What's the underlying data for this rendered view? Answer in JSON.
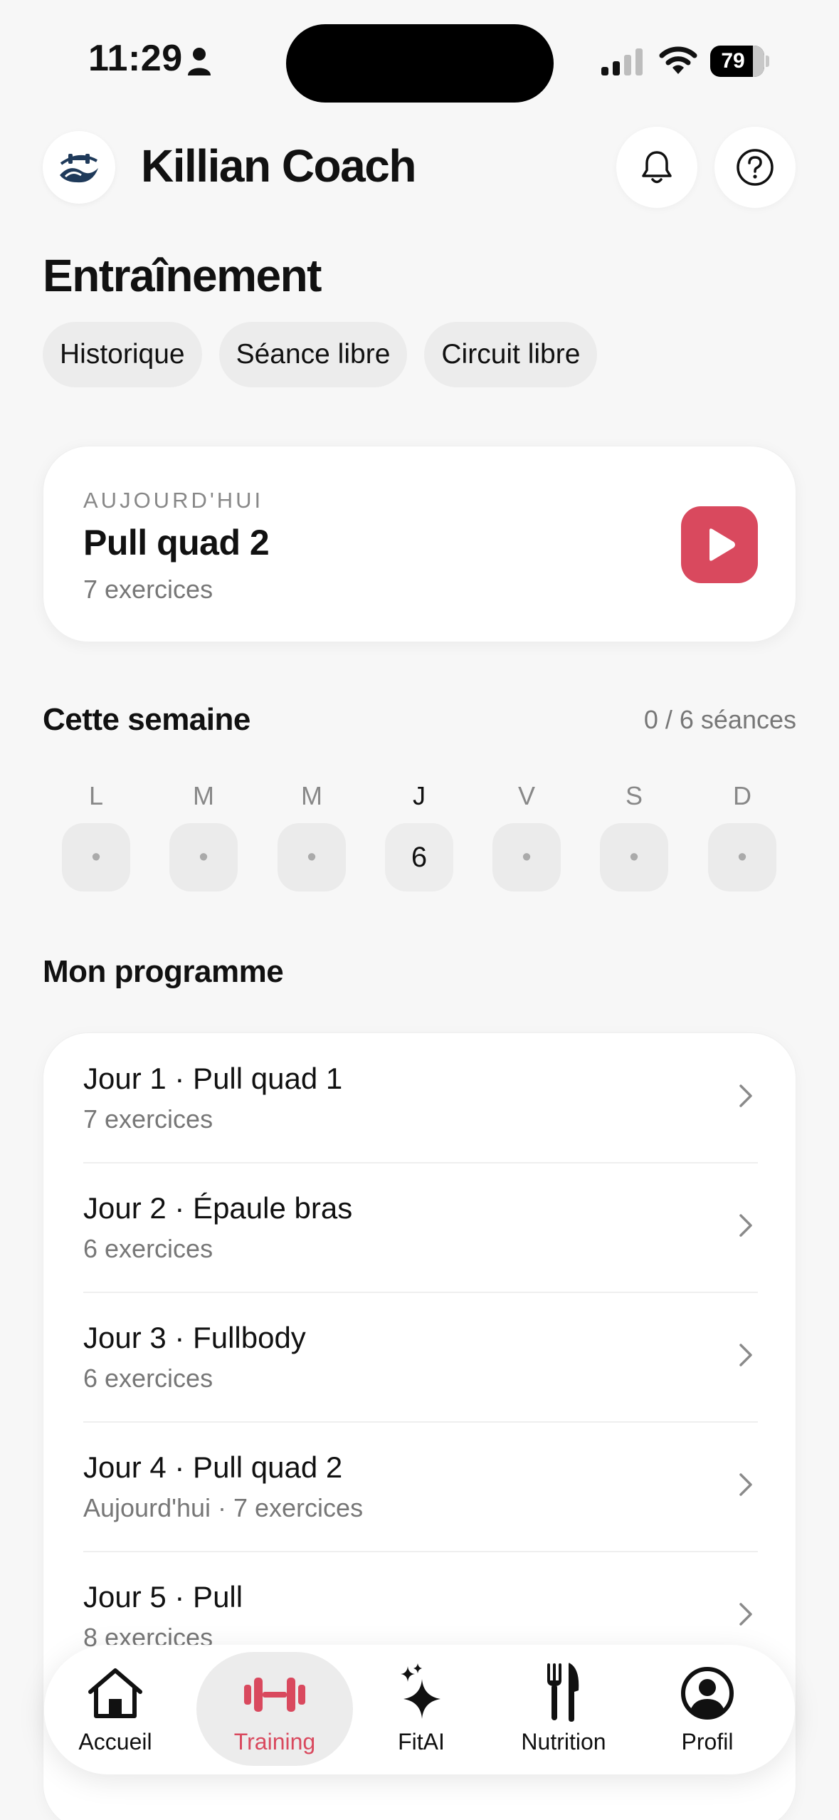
{
  "status_bar": {
    "time": "11:29",
    "battery": "79"
  },
  "header": {
    "title": "Killian Coach"
  },
  "section": {
    "title": "Entraînement",
    "chips": [
      "Historique",
      "Séance libre",
      "Circuit libre"
    ]
  },
  "today": {
    "kicker": "AUJOURD'HUI",
    "title": "Pull quad 2",
    "subtitle": "7 exercices"
  },
  "week": {
    "title": "Cette semaine",
    "count": "0 / 6 séances",
    "days": [
      {
        "label": "L",
        "value": "•"
      },
      {
        "label": "M",
        "value": "•"
      },
      {
        "label": "M",
        "value": "•"
      },
      {
        "label": "J",
        "value": "6"
      },
      {
        "label": "V",
        "value": "•"
      },
      {
        "label": "S",
        "value": "•"
      },
      {
        "label": "D",
        "value": "•"
      }
    ]
  },
  "program": {
    "title": "Mon programme",
    "items": [
      {
        "title": "Jour 1 · Pull quad 1",
        "subtitle": "7 exercices"
      },
      {
        "title": "Jour 2 · Épaule bras",
        "subtitle": "6 exercices"
      },
      {
        "title": "Jour 3 · Fullbody",
        "subtitle": "6 exercices"
      },
      {
        "title": "Jour 4 · Pull quad 2",
        "subtitle": "Aujourd'hui · 7 exercices"
      },
      {
        "title": "Jour 5 · Pull",
        "subtitle": "8 exercices"
      }
    ]
  },
  "nav": {
    "items": [
      {
        "label": "Accueil",
        "icon": "home-icon"
      },
      {
        "label": "Training",
        "icon": "dumbbell-icon"
      },
      {
        "label": "FitAI",
        "icon": "sparkles-icon"
      },
      {
        "label": "Nutrition",
        "icon": "fork-knife-icon"
      },
      {
        "label": "Profil",
        "icon": "profile-icon"
      }
    ],
    "active": "Training"
  },
  "colors": {
    "accent": "#d9495e",
    "background": "#f7f7f7",
    "card": "#ffffff",
    "chip": "#ececec"
  }
}
